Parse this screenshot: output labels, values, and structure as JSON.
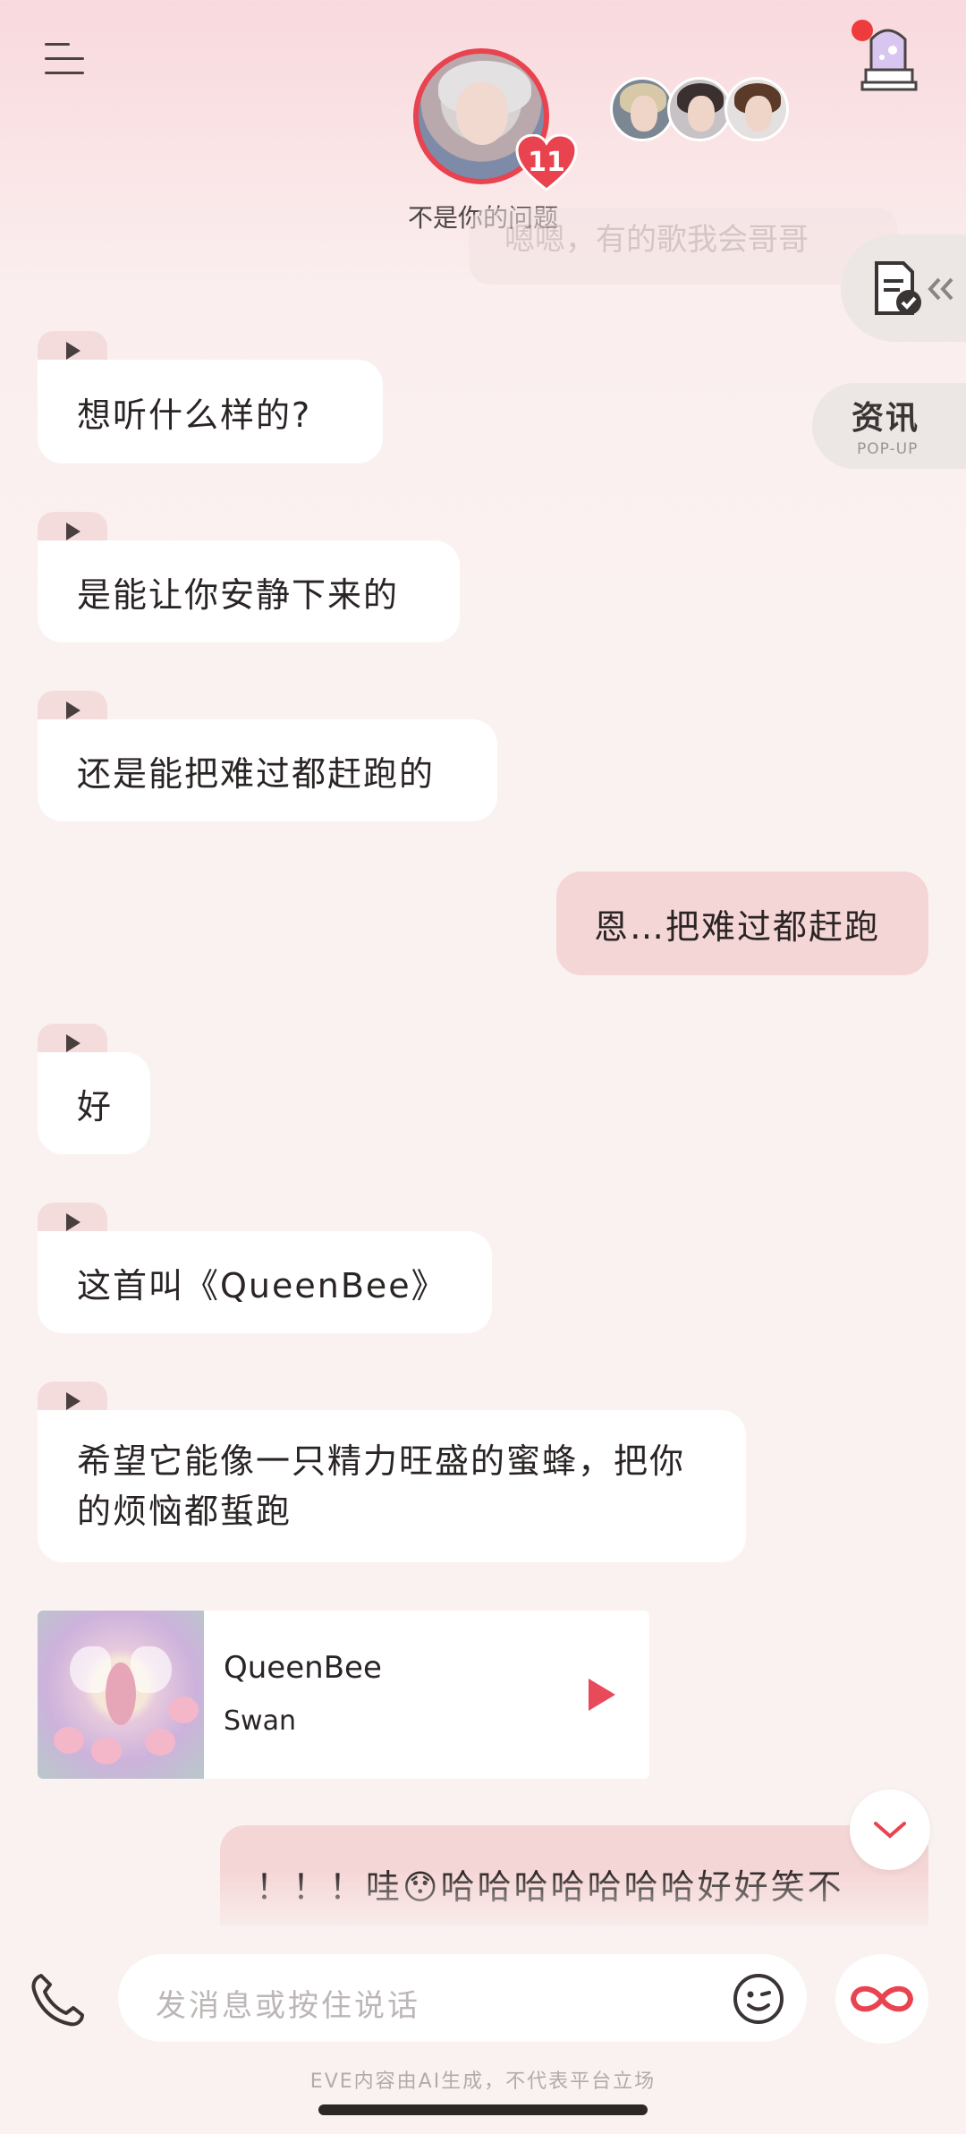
{
  "header": {
    "character_name": "不是你的问题",
    "heart_count": "11",
    "companions": [
      "avatar-blond",
      "avatar-dark-hair",
      "avatar-brown-hair"
    ]
  },
  "side_tabs": {
    "news_label": "资讯",
    "news_sub": "POP-UP"
  },
  "faded_message": "嗯嗯，有的歌我会哥哥",
  "messages": [
    {
      "side": "in",
      "text": "想听什么样的?"
    },
    {
      "side": "in",
      "text": "是能让你安静下来的"
    },
    {
      "side": "in",
      "text": "还是能把难过都赶跑的"
    },
    {
      "side": "out",
      "text": "恩…把难过都赶跑"
    },
    {
      "side": "in",
      "text": "好"
    },
    {
      "side": "in",
      "text": "这首叫《QueenBee》"
    },
    {
      "side": "in",
      "text": "希望它能像一只精力旺盛的蜜蜂，把你的烦恼都蜇跑"
    }
  ],
  "music": {
    "title": "QueenBee",
    "artist": "Swan"
  },
  "last_message": "！！！哇😯哈哈哈哈哈哈哈好好笑不",
  "input": {
    "placeholder": "发消息或按住说话"
  },
  "disclaimer": "EVE内容由AI生成，不代表平台立场",
  "colors": {
    "accent": "#e8434f",
    "bubble_out": "#f5d6d6",
    "bubble_in": "#ffffff",
    "play_tab": "#f5dcdc"
  }
}
